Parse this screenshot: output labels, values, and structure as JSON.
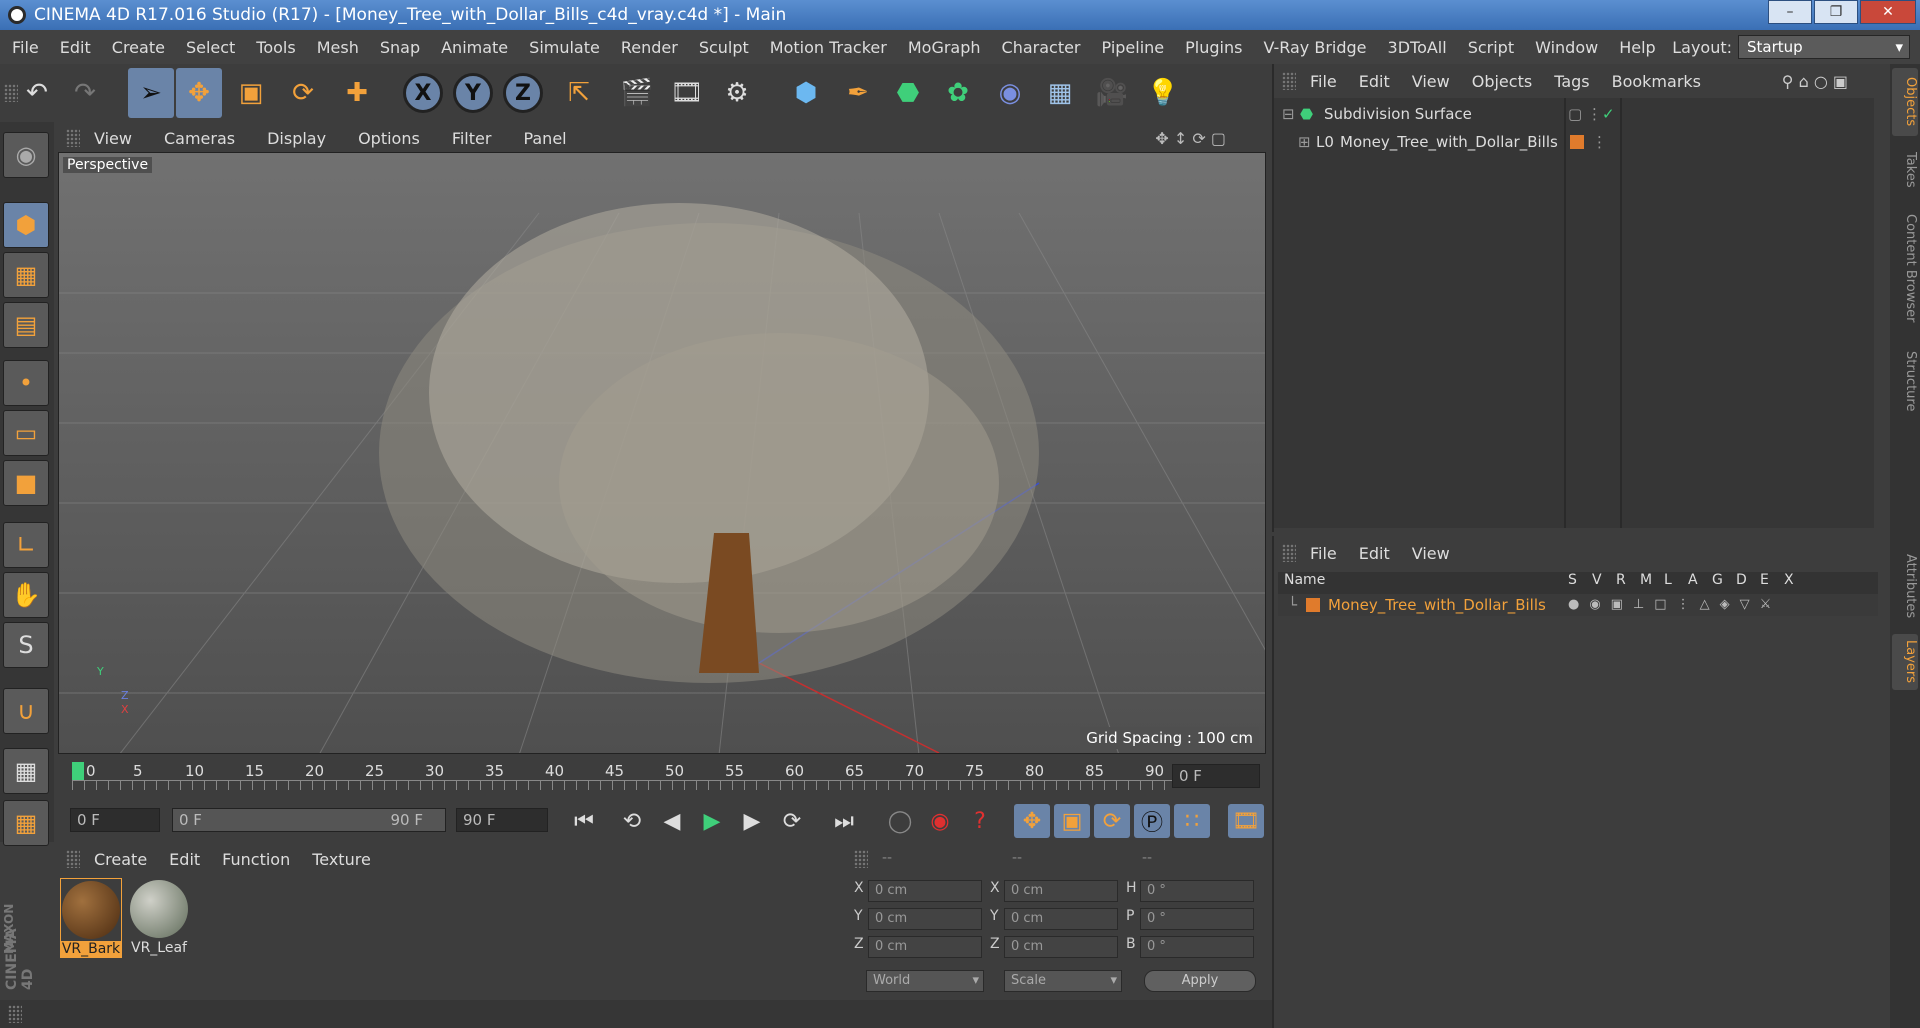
{
  "window": {
    "title": "CINEMA 4D R17.016 Studio (R17) - [Money_Tree_with_Dollar_Bills_c4d_vray.c4d *] - Main"
  },
  "menubar": {
    "items": [
      "File",
      "Edit",
      "Create",
      "Select",
      "Tools",
      "Mesh",
      "Snap",
      "Animate",
      "Simulate",
      "Render",
      "Sculpt",
      "Motion Tracker",
      "MoGraph",
      "Character",
      "Pipeline",
      "Plugins",
      "V-Ray Bridge",
      "3DToAll",
      "Script",
      "Window",
      "Help"
    ],
    "layout_label": "Layout:",
    "layout_value": "Startup"
  },
  "toolbar": {
    "undo_icon": "undo-icon",
    "redo_icon": "redo-icon",
    "x_label": "X",
    "y_label": "Y",
    "z_label": "Z"
  },
  "viewport": {
    "menu": [
      "View",
      "Cameras",
      "Display",
      "Options",
      "Filter",
      "Panel"
    ],
    "camera_label": "Perspective",
    "grid_spacing": "Grid Spacing : 100 cm",
    "axis_y": "Y",
    "axis_z": "Z",
    "axis_x": "X"
  },
  "timeline": {
    "ticks": [
      "0",
      "5",
      "10",
      "15",
      "20",
      "25",
      "30",
      "35",
      "40",
      "45",
      "50",
      "55",
      "60",
      "65",
      "70",
      "75",
      "80",
      "85",
      "90"
    ],
    "current_frame": "0 F",
    "start_frame": "0 F",
    "range_start": "0 F",
    "range_end": "90 F",
    "end_frame": "90 F"
  },
  "material_panel": {
    "menu": [
      "Create",
      "Edit",
      "Function",
      "Texture"
    ],
    "materials": [
      {
        "name": "VR_Bark"
      },
      {
        "name": "VR_Leaf"
      }
    ]
  },
  "coordinates": {
    "header": [
      "--",
      "--",
      "--"
    ],
    "rows": [
      {
        "a": "X",
        "av": "0 cm",
        "b": "X",
        "bv": "0 cm",
        "c": "H",
        "cv": "0 °"
      },
      {
        "a": "Y",
        "av": "0 cm",
        "b": "Y",
        "bv": "0 cm",
        "c": "P",
        "cv": "0 °"
      },
      {
        "a": "Z",
        "av": "0 cm",
        "b": "Z",
        "bv": "0 cm",
        "c": "B",
        "cv": "0 °"
      }
    ],
    "mode": "World",
    "scale": "Scale",
    "apply": "Apply"
  },
  "object_manager": {
    "menu": [
      "File",
      "Edit",
      "View",
      "Objects",
      "Tags",
      "Bookmarks"
    ],
    "objects": [
      {
        "name": "Subdivision Surface"
      },
      {
        "name": "Money_Tree_with_Dollar_Bills"
      }
    ]
  },
  "layer_manager": {
    "menu": [
      "File",
      "Edit",
      "View"
    ],
    "columns": [
      "Name",
      "S",
      "V",
      "R",
      "M",
      "L",
      "A",
      "G",
      "D",
      "E",
      "X"
    ],
    "layers": [
      {
        "name": "Money_Tree_with_Dollar_Bills",
        "color": "#e07b2c"
      }
    ]
  },
  "side_tabs": [
    "Objects",
    "Takes",
    "Content Browser",
    "Structure",
    "Attributes",
    "Layers"
  ],
  "brand": {
    "maxon": "MAXON",
    "cinema": "CINEMA 4D"
  },
  "colors": {
    "accent": "#f2a13b",
    "selection": "#6a84a8",
    "layer_text": "#f2a13b"
  }
}
